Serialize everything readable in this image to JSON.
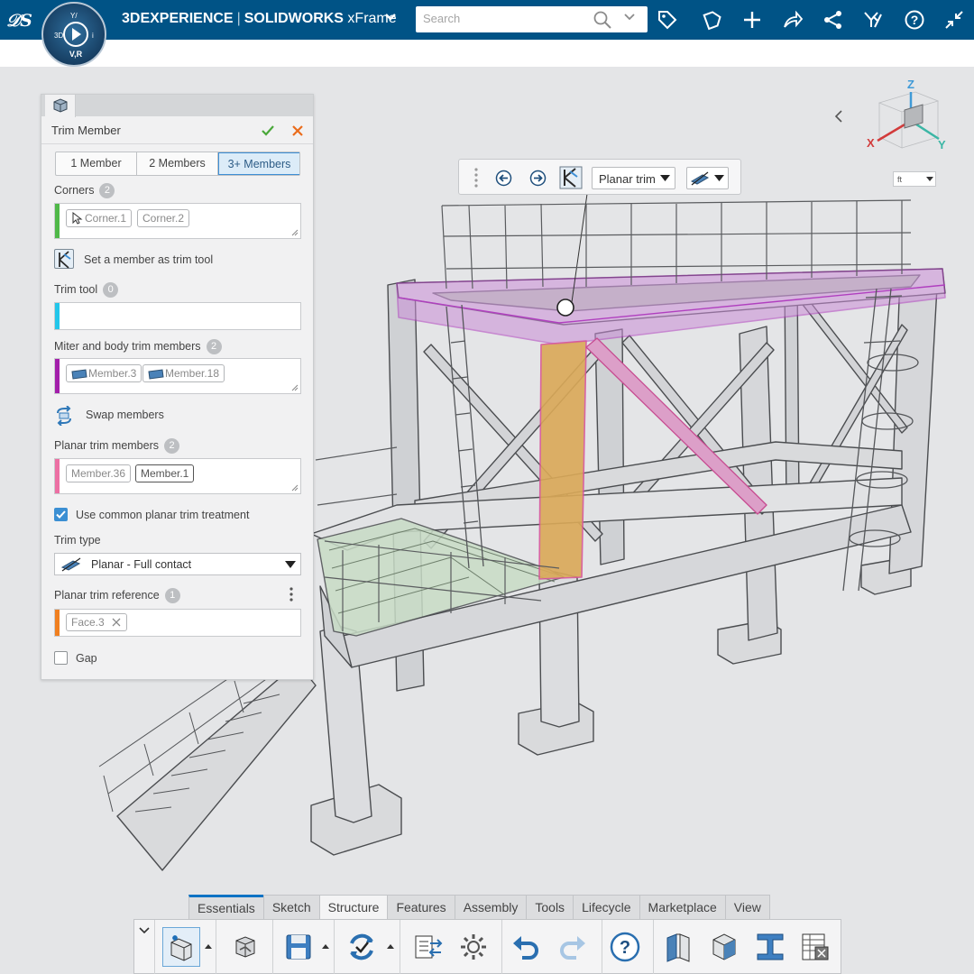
{
  "app": {
    "brand": "3DEXPERIENCE",
    "separator": "|",
    "product": "SOLIDWORKS",
    "role": "xFrame",
    "compass_label": "V,R"
  },
  "search": {
    "placeholder": "Search"
  },
  "top_icons": [
    "tag-icon",
    "share-icon",
    "add-icon",
    "forward-icon",
    "network-icon",
    "community-icon",
    "help-icon",
    "collapse-icon"
  ],
  "panel": {
    "title": "Trim Member",
    "modes": [
      "1 Member",
      "2 Members",
      "3+ Members"
    ],
    "active_mode": "3+ Members",
    "corners": {
      "label": "Corners",
      "count": "2",
      "chips": [
        "Corner.1",
        "Corner.2"
      ],
      "stripe_color": "#4fb848"
    },
    "set_trim_tool": "Set a member as trim tool",
    "trim_tool": {
      "label": "Trim tool",
      "count": "0",
      "stripe_color": "#22c6ea"
    },
    "miter": {
      "label": "Miter and body trim members",
      "count": "2",
      "chips": [
        "Member.3",
        "Member.18"
      ],
      "stripe_color": "#a21eaa"
    },
    "swap_members": "Swap members",
    "planar": {
      "label": "Planar trim members",
      "count": "2",
      "chips": [
        "Member.36",
        "Member.1"
      ],
      "stripe_color": "#ec6fa3"
    },
    "common_treatment": {
      "label": "Use common planar trim treatment",
      "checked": true
    },
    "trim_type": {
      "label": "Trim type",
      "value": "Planar - Full contact"
    },
    "reference": {
      "label": "Planar trim reference",
      "count": "1",
      "chips": [
        "Face.3"
      ],
      "stripe_color": "#f07f1f"
    },
    "gap": {
      "label": "Gap",
      "checked": false
    }
  },
  "context_toolbar": {
    "dropdown": "Planar trim"
  },
  "units": "ft",
  "triad": {
    "x": "X",
    "y": "Y",
    "z": "Z"
  },
  "tabs": [
    "Essentials",
    "Sketch",
    "Structure",
    "Features",
    "Assembly",
    "Tools",
    "Lifecycle",
    "Marketplace",
    "View"
  ],
  "active_tab": "Structure",
  "colors": {
    "topbar": "#005386",
    "accent": "#3d8fd6",
    "highlight_member": "#d8a548",
    "highlight_frame": "#c07ad0",
    "ok": "#4aa83a",
    "cancel": "#ea6c1b"
  }
}
